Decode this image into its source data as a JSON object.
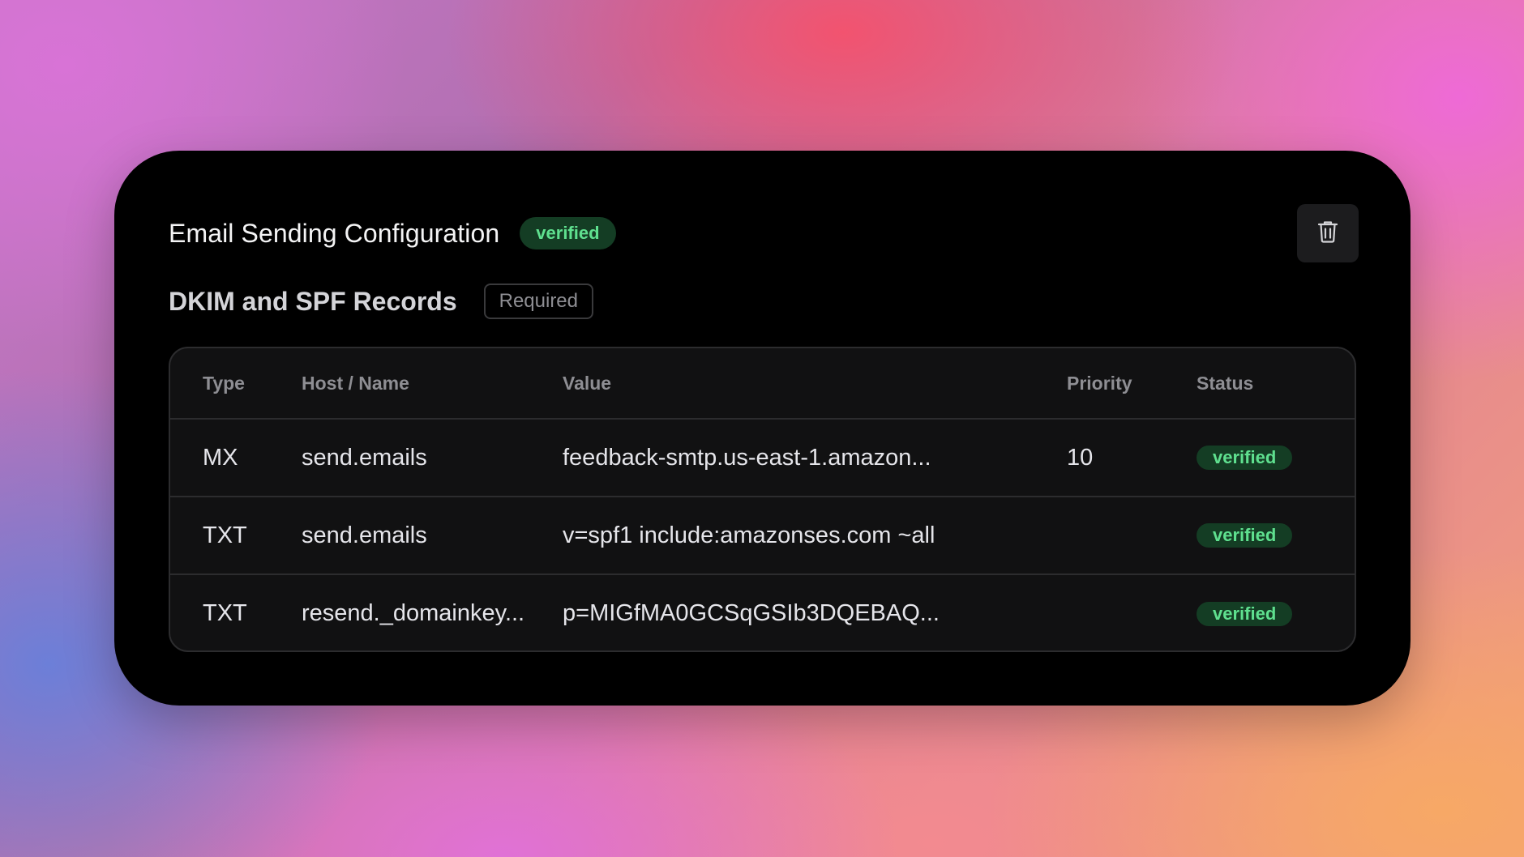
{
  "header": {
    "title": "Email Sending Configuration",
    "status_badge": "verified",
    "delete_icon": "trash-icon"
  },
  "records": {
    "title": "DKIM and SPF Records",
    "tag": "Required"
  },
  "table": {
    "columns": [
      "Type",
      "Host / Name",
      "Value",
      "Priority",
      "Status"
    ],
    "rows": [
      {
        "type": "MX",
        "host": "send.emails",
        "value": "feedback-smtp.us-east-1.amazon...",
        "priority": "10",
        "status": "verified"
      },
      {
        "type": "TXT",
        "host": "send.emails",
        "value": "v=spf1 include:amazonses.com ~all",
        "priority": "",
        "status": "verified"
      },
      {
        "type": "TXT",
        "host": "resend._domainkey...",
        "value": "p=MIGfMA0GCSqGSIb3DQEBAQ...",
        "priority": "",
        "status": "verified"
      }
    ]
  },
  "colors": {
    "card_bg": "#000000",
    "verified_bg": "#143d24",
    "verified_text": "#5fe08f"
  }
}
